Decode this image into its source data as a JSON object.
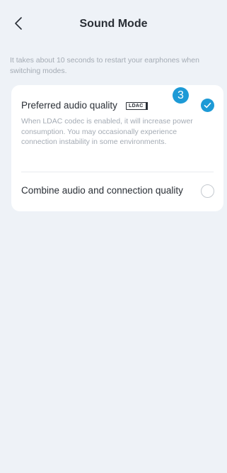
{
  "header": {
    "title": "Sound Mode",
    "back_icon": "chevron-left-icon"
  },
  "hint": "It takes about 10 seconds to restart your earphones when switching modes.",
  "options": [
    {
      "title": "Preferred audio quality",
      "badge": "LDAC",
      "description": "When LDAC codec is enabled, it will increase power consumption. You may occasionally experience connection instability in some environments.",
      "selected": true,
      "marker": "3"
    },
    {
      "title": "Combine audio and connection quality",
      "selected": false
    }
  ],
  "colors": {
    "accent": "#1d9ad6",
    "background": "#eef2f7",
    "card": "#ffffff",
    "muted_text": "#a4abb4"
  }
}
